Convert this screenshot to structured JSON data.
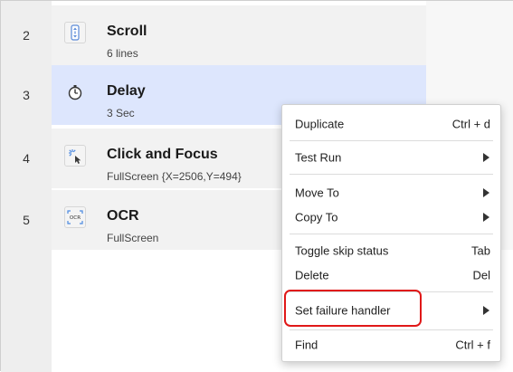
{
  "steps": [
    {
      "number": "2",
      "title": "Scroll",
      "subtitle": "6 lines",
      "icon": "scroll-icon"
    },
    {
      "number": "3",
      "title": "Delay",
      "subtitle": "3 Sec",
      "icon": "timer-icon",
      "selected": true
    },
    {
      "number": "4",
      "title": "Click and Focus",
      "subtitle": "FullScreen {X=2506,Y=494}",
      "icon": "click-cursor-icon"
    },
    {
      "number": "5",
      "title": "OCR",
      "subtitle": "FullScreen",
      "icon": "ocr-icon"
    }
  ],
  "context_menu": {
    "duplicate": {
      "label": "Duplicate",
      "shortcut": "Ctrl + d"
    },
    "test_run": {
      "label": "Test Run"
    },
    "move_to": {
      "label": "Move To"
    },
    "copy_to": {
      "label": "Copy To"
    },
    "toggle_skip": {
      "label": "Toggle skip status",
      "shortcut": "Tab"
    },
    "delete": {
      "label": "Delete",
      "shortcut": "Del"
    },
    "set_failure_handler": {
      "label": "Set failure handler"
    },
    "find": {
      "label": "Find",
      "shortcut": "Ctrl + f"
    }
  },
  "colors": {
    "selected_row": "#dde6fd",
    "highlight_border": "#e01818"
  }
}
